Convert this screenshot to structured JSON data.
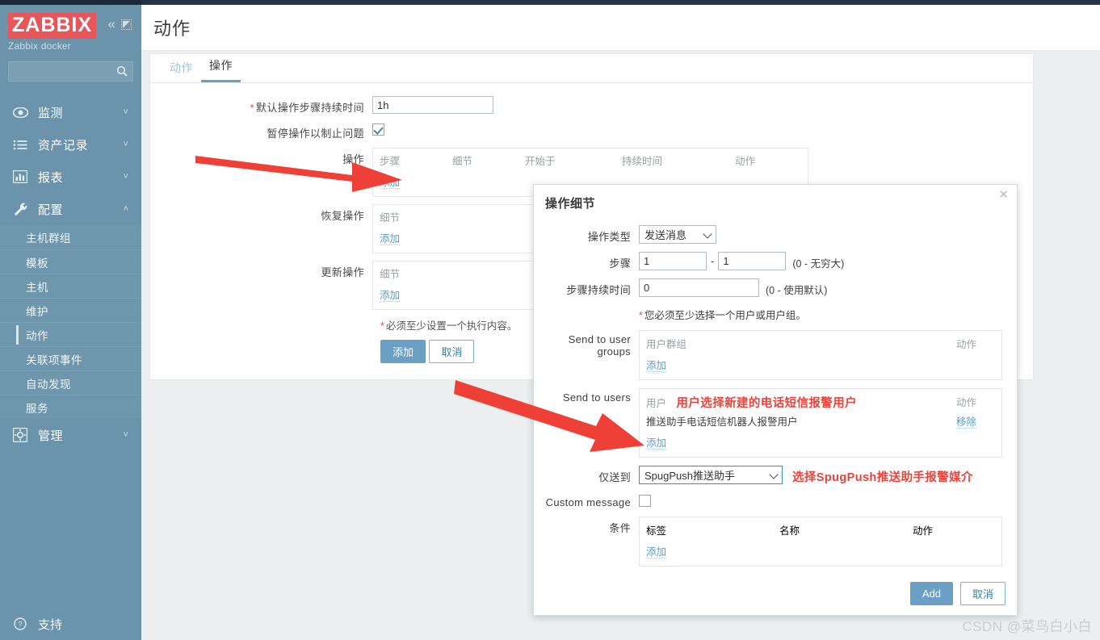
{
  "sidebar": {
    "brand": "ZABBIX",
    "subtitle": "Zabbix docker",
    "search_placeholder": "",
    "search_value": "",
    "collapse_icon": "chevron-double-left-icon",
    "expand_icon": "expand-icon",
    "items": [
      {
        "label": "监测",
        "icon": "eye-icon",
        "chevron": "˅"
      },
      {
        "label": "资产记录",
        "icon": "list-icon",
        "chevron": "˅"
      },
      {
        "label": "报表",
        "icon": "chart-icon",
        "chevron": "˅"
      },
      {
        "label": "配置",
        "icon": "wrench-icon",
        "chevron": "˄"
      }
    ],
    "config_children": [
      {
        "label": "主机群组",
        "selected": false
      },
      {
        "label": "模板",
        "selected": false
      },
      {
        "label": "主机",
        "selected": false
      },
      {
        "label": "维护",
        "selected": false
      },
      {
        "label": "动作",
        "selected": true
      },
      {
        "label": "关联项事件",
        "selected": false
      },
      {
        "label": "自动发现",
        "selected": false
      },
      {
        "label": "服务",
        "selected": false
      }
    ],
    "management": {
      "label": "管理",
      "icon": "gear-icon",
      "chevron": "˅"
    },
    "support": {
      "label": "支持",
      "icon": "question-icon"
    }
  },
  "header": {
    "title": "动作"
  },
  "tabs": [
    {
      "label": "动作",
      "active": false
    },
    {
      "label": "操作",
      "active": true
    }
  ],
  "form": {
    "default_step_duration_label": "默认操作步骤持续时间",
    "default_step_duration_value": "1h",
    "pause_label": "暂停操作以制止问题",
    "pause_checked": true,
    "operations_label": "操作",
    "operations_columns": [
      "步骤",
      "细节",
      "开始于",
      "持续时间",
      "动作"
    ],
    "operations_add": "添加",
    "recovery_label": "恢复操作",
    "recovery_columns": [
      "细节"
    ],
    "recovery_add": "添加",
    "update_label": "更新操作",
    "update_columns": [
      "细节"
    ],
    "update_add": "添加",
    "required_note": "必须至少设置一个执行内容。",
    "submit_label": "添加",
    "cancel_label": "取消"
  },
  "modal": {
    "title": "操作细节",
    "close_icon": "close-icon",
    "operation_type_label": "操作类型",
    "operation_type_value": "发送消息",
    "step_label": "步骤",
    "step_from": "1",
    "step_to": "1",
    "step_separator": "-",
    "step_note": "(0 - 无穷大)",
    "step_duration_label": "步骤持续时间",
    "step_duration_value": "0",
    "step_duration_note": "(0 - 使用默认)",
    "required_note": "您必须至少选择一个用户或用户组。",
    "send_to_user_groups_label": "Send to user groups",
    "user_groups_columns": [
      "用户群组",
      "动作"
    ],
    "user_groups_add": "添加",
    "send_to_users_label": "Send to users",
    "users_columns": [
      "用户",
      "动作"
    ],
    "users_rows": [
      {
        "name": "推送助手电话短信机器人报警用户",
        "action": "移除"
      }
    ],
    "users_add": "添加",
    "send_only_to_label": "仅送到",
    "send_only_to_value": "SpugPush推送助手",
    "custom_message_label": "Custom message",
    "custom_message_checked": false,
    "conditions_label": "条件",
    "conditions_columns": [
      "标签",
      "名称",
      "动作"
    ],
    "conditions_add": "添加",
    "add_label": "Add",
    "cancel_label": "取消"
  },
  "annotations": {
    "users_note": "用户选择新建的电话短信报警用户",
    "media_note": "选择SpugPush推送助手报警媒介",
    "arrow_color": "#ee4036"
  },
  "watermark": "CSDN @菜鸟白小白"
}
